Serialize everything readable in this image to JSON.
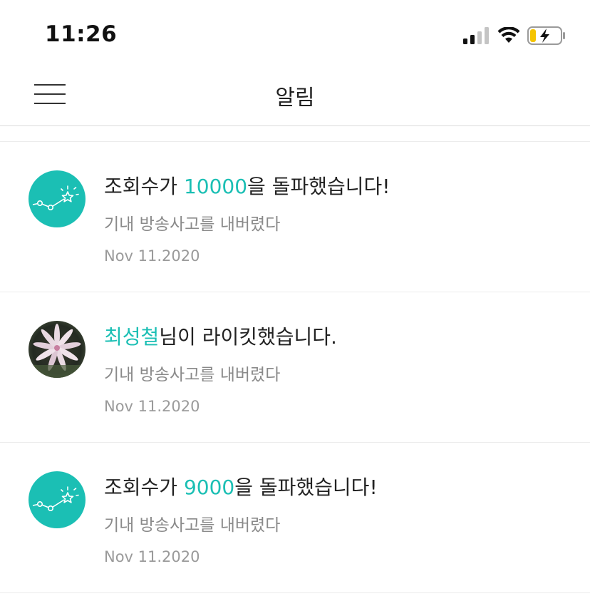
{
  "status_bar": {
    "time": "11:26"
  },
  "nav": {
    "title": "알림"
  },
  "notifications": [
    {
      "title_before": "조회수가 ",
      "highlight": "10000",
      "title_after": "을 돌파했습니다!",
      "subtitle": "기내 방송사고를 내버렸다",
      "date": "Nov 11.2020",
      "avatar": "views-chart-icon"
    },
    {
      "title_before": "",
      "highlight": "최성철",
      "title_after": "님이 라이킷했습니다.",
      "subtitle": "기내 방송사고를 내버렸다",
      "date": "Nov 11.2020",
      "avatar": "user-photo"
    },
    {
      "title_before": "조회수가 ",
      "highlight": "9000",
      "title_after": "을 돌파했습니다!",
      "subtitle": "기내 방송사고를 내버렸다",
      "date": "Nov 11.2020",
      "avatar": "views-chart-icon"
    }
  ],
  "colors": {
    "accent": "#1bbfb4",
    "battery": "#f5c400"
  }
}
